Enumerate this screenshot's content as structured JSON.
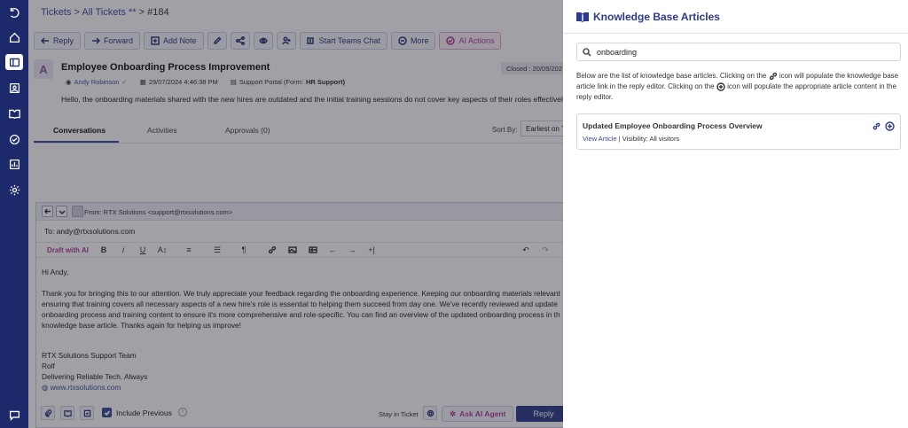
{
  "breadcrumb": {
    "tickets": "Tickets",
    "sep1": ">",
    "all_tickets": "All Tickets **",
    "sep2": ">",
    "current": "#184"
  },
  "toolbar": {
    "reply": "Reply",
    "forward": "Forward",
    "add_note": "Add Note",
    "teams": "Start Teams Chat",
    "more": "More",
    "ai_actions": "AI Actions"
  },
  "ticket": {
    "avatar_letter": "A",
    "title": "Employee Onboarding Process Improvement",
    "requester": "Andy Robinson",
    "datetime": "29/07/2024 4:46:38 PM",
    "source": "Support Portal (Form:",
    "form_name": "HR Support)",
    "closed": "Closed : 20/05/202",
    "description": "Hello, the onboarding materials shared with the new hires are outdated and the initial training sessions do not cover key aspects of their roles effectively"
  },
  "tabs": {
    "conversations": "Conversations",
    "activities": "Activities",
    "approvals": "Approvals (0)"
  },
  "sort": {
    "label": "Sort By:",
    "value": "Earliest on To"
  },
  "reply": {
    "from": "From: RTX Solutions <support@rtxsolutions.com>",
    "to": "To: andy@rtxsolutions.com",
    "draft_ai": "Draft with AI",
    "greeting": "Hi Andy,",
    "line1": "Thank you for bringing this to our attention. We truly appreciate your feedback regarding the onboarding experience. Keeping our onboarding materials relevant",
    "line2": "ensuring that training covers all necessary aspects of a new hire's role is essential to helping them succeed from day one. We've recently reviewed and update",
    "line3": "onboarding process and training content to ensure it's more comprehensive and role-specific. You can find an overview of the updated onboarding process in th",
    "line4": "knowledge base article. Thanks again for helping us improve!",
    "sig1": "RTX Solutions Support Team",
    "sig2": "Rolf",
    "sig3": "Delivering Reliable Tech. Always",
    "sig4": "www.rtxsolutions.com",
    "include_previous": "Include Previous",
    "stay_in_ticket": "Stay in Ticket",
    "ask_ai": "Ask AI Agent",
    "reply_btn": "Reply"
  },
  "kb_panel": {
    "title": "Knowledge Base Articles",
    "search_value": "onboarding",
    "desc_a": "Below are the list of knowledge base articles. Clicking on the",
    "desc_b": "icon will populate the knowledge base article link in the reply editor. Clicking on the",
    "desc_c": "icon will populate the appropriate article content in the reply editor.",
    "article": {
      "title": "Updated Employee Onboarding Process Overview",
      "view": "View Article",
      "visibility": "| Visibility: All visitors"
    }
  },
  "colors": {
    "sidebar": "#1c2a6b",
    "accent": "#2d3a8c",
    "ai": "#b03a9e"
  }
}
